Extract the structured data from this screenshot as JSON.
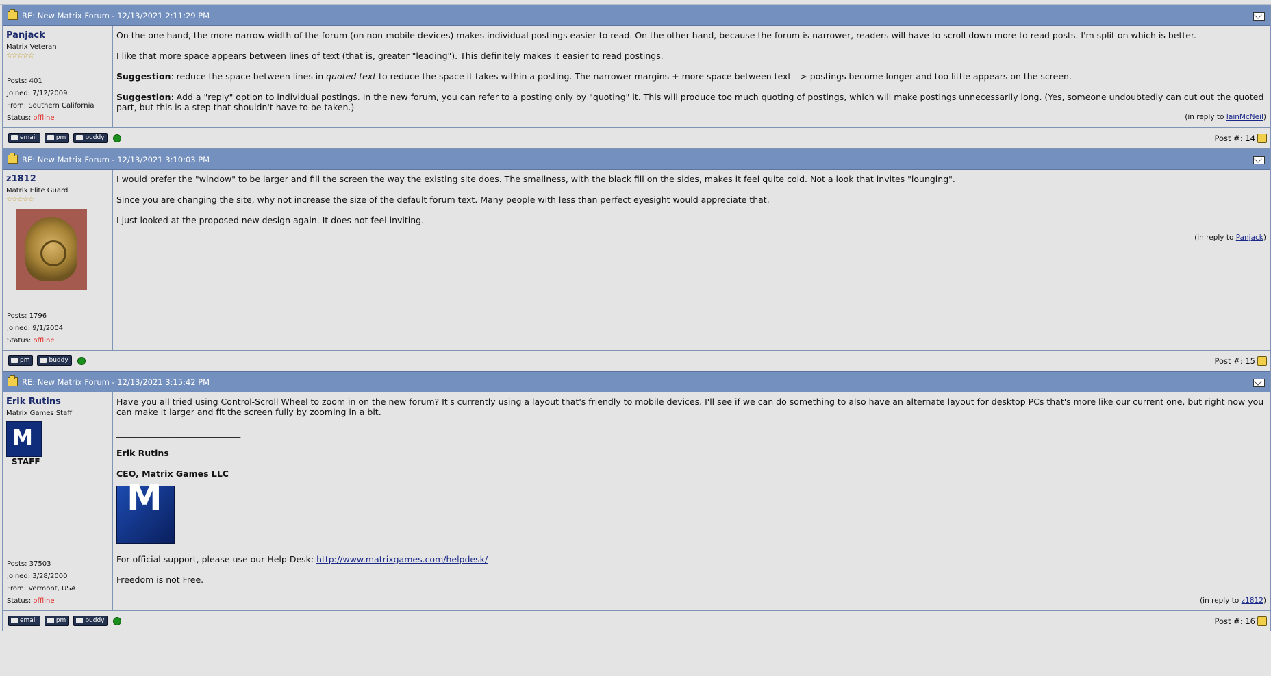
{
  "posts": [
    {
      "title": "RE: New Matrix Forum - 12/13/2021 2:11:29 PM",
      "username": "Panjack",
      "rank": "Matrix Veteran",
      "stars": "☆☆☆☆☆",
      "stats": {
        "posts": "Posts: 401",
        "joined": "Joined: 7/12/2009",
        "from": "From: Southern California",
        "status_label": "Status: ",
        "status": "offline"
      },
      "paragraphs": [
        "On the one hand, the more narrow width of the forum (on non-mobile devices) makes individual postings easier to read. On the other hand, because the forum is narrower, readers will have to scroll down more to read posts. I'm split on which is better.",
        "I like that more space appears between lines of text (that is, greater \"leading\"). This definitely makes it easier to read postings."
      ],
      "suggestion1": {
        "label": "Suggestion",
        "a": ": reduce the space between lines in ",
        "em": "quoted text",
        "b": " to reduce the space it takes within a posting. The narrower margins + more space between text --> postings become longer and too little appears on the screen."
      },
      "suggestion2": {
        "label": "Suggestion",
        "text": ": Add a \"reply\" option to individual postings. In the new forum, you can refer to a posting only by \"quoting\" it. This will produce too much quoting of postings, which will make postings unnecessarily long. (Yes, someone undoubtedly can cut out the quoted part, but this is a step that shouldn't have to be taken.)"
      },
      "in_reply_prefix": "(in reply to ",
      "in_reply_to": "IainMcNeil",
      "in_reply_suffix": ")",
      "buttons": [
        "email",
        "pm",
        "buddy"
      ],
      "post_number": "Post #: 14"
    },
    {
      "title": "RE: New Matrix Forum - 12/13/2021 3:10:03 PM",
      "username": "z1812",
      "rank": "Matrix Elite Guard",
      "stars": "☆☆☆☆☆",
      "stats": {
        "posts": "Posts: 1796",
        "joined": "Joined: 9/1/2004",
        "status_label": "Status: ",
        "status": "offline"
      },
      "paragraphs": [
        "I would prefer the \"window\" to be larger and fill the screen the way the existing site does. The smallness, with the black fill on the sides, makes it feel quite cold. Not a look that invites \"lounging\".",
        "Since you are changing the site, why not increase the size of the default forum text. Many people with less than perfect eyesight would appreciate that.",
        "I just looked at the proposed new design again. It does not feel inviting."
      ],
      "in_reply_prefix": "(in reply to ",
      "in_reply_to": "Panjack",
      "in_reply_suffix": ")",
      "buttons": [
        "pm",
        "buddy"
      ],
      "post_number": "Post #: 15"
    },
    {
      "title": "RE: New Matrix Forum - 12/13/2021 3:15:42 PM",
      "username": "Erik Rutins",
      "rank": "Matrix Games Staff",
      "staff_label": "STAFF",
      "stats": {
        "posts": "Posts: 37503",
        "joined": "Joined: 3/28/2000",
        "from": "From: Vermont, USA",
        "status_label": "Status: ",
        "status": "offline"
      },
      "paragraphs": [
        "Have you all tried using Control-Scroll Wheel to zoom in on the new forum? It's currently using a layout that's friendly to mobile devices. I'll see if we can do something to also have an alternate layout for desktop PCs that's more like our current one, but right now you can make it larger and fit the screen fully by zooming in a bit."
      ],
      "separator": "_____________________________",
      "sig_name": "Erik Rutins",
      "sig_title": "CEO, Matrix Games LLC",
      "support_text": "For official support, please use our Help Desk: ",
      "support_link": "http://www.matrixgames.com/helpdesk/",
      "motto": "Freedom is not Free.",
      "in_reply_prefix": "(in reply to ",
      "in_reply_to": "z1812",
      "in_reply_suffix": ")",
      "buttons": [
        "email",
        "pm",
        "buddy"
      ],
      "post_number": "Post #: 16"
    }
  ],
  "icons": {
    "folder": "folder-icon",
    "mail": "envelope-icon",
    "online": "online-status-icon",
    "post_icon": "post-icon"
  },
  "colors": {
    "header": "#7390bf",
    "background": "#e4e4e4",
    "offline": "#e0211d",
    "online": "#1b8f1b"
  }
}
